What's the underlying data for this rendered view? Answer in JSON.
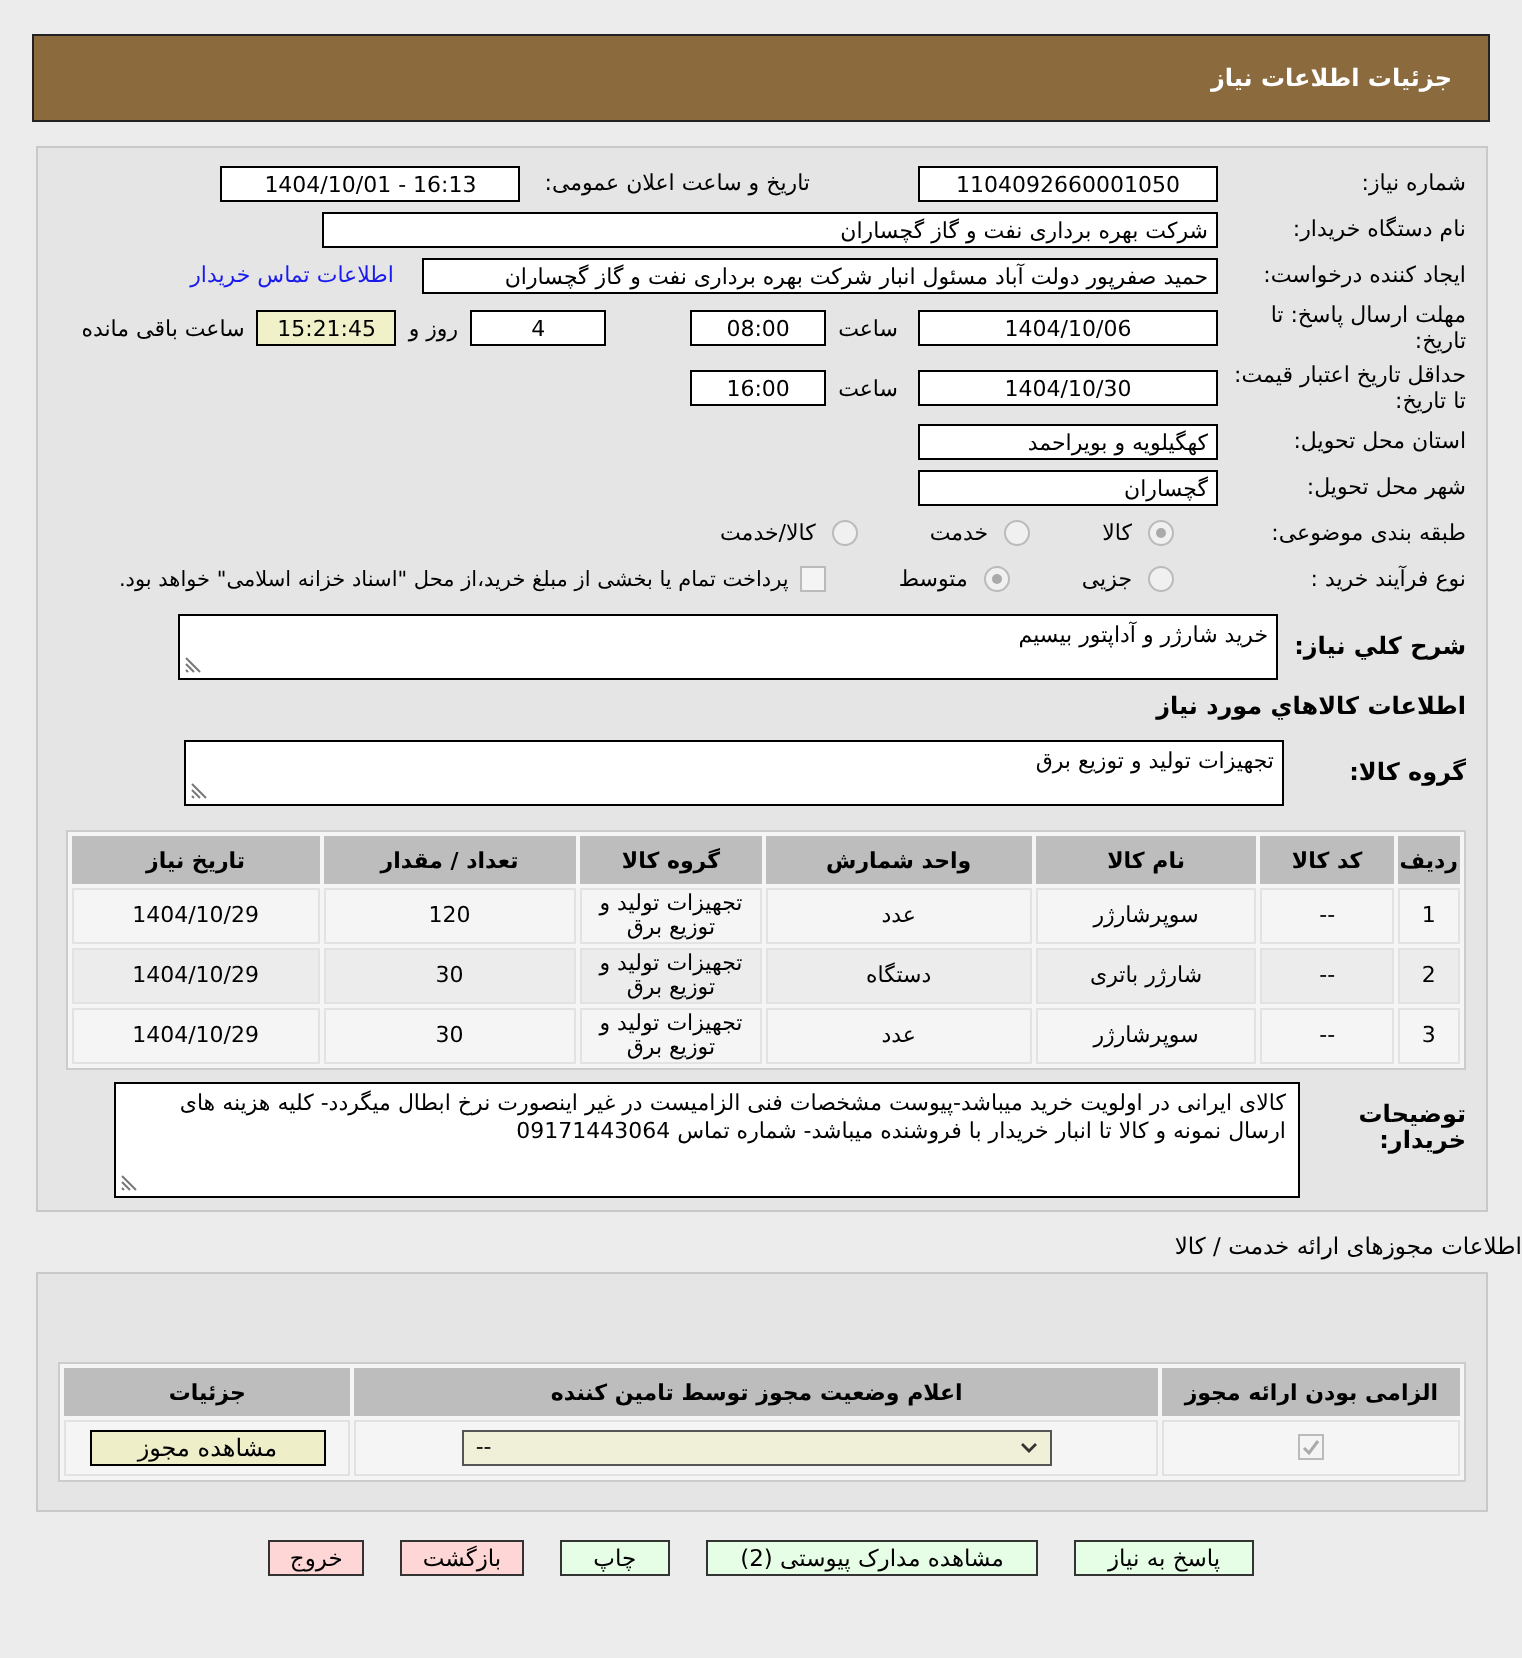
{
  "header": {
    "title": "جزئیات اطلاعات نیاز"
  },
  "need_number": {
    "label": "شماره نیاز:",
    "value": "1104092660001050"
  },
  "announce": {
    "label": "تاریخ و ساعت اعلان عمومی:",
    "value": "1404/10/01 - 16:13"
  },
  "buyer": {
    "label": "نام دستگاه خریدار:",
    "value": "شرکت بهره برداری نفت و گاز گچساران"
  },
  "requester": {
    "label": "ایجاد کننده درخواست:",
    "value": "حمید  صفرپور دولت آباد مسئول انبار شرکت بهره برداری نفت و گاز گچساران",
    "link": "اطلاعات تماس خریدار"
  },
  "deadline": {
    "label": "مهلت ارسال پاسخ: تا تاریخ:",
    "date": "1404/10/06",
    "time_label": "ساعت",
    "time": "08:00",
    "days": "4",
    "days_label": "روز و",
    "remaining": "15:21:45",
    "remaining_label": "ساعت باقی مانده"
  },
  "validity": {
    "label": "حداقل تاریخ اعتبار قیمت: تا تاریخ:",
    "date": "1404/10/30",
    "time_label": "ساعت",
    "time": "16:00"
  },
  "province": {
    "label": "استان محل تحویل:",
    "value": "کهگیلویه و بویراحمد"
  },
  "city": {
    "label": "شهر محل تحویل:",
    "value": "گچساران"
  },
  "category": {
    "label": "طبقه بندی موضوعی:",
    "options": [
      {
        "label": "کالا",
        "selected": true
      },
      {
        "label": "خدمت",
        "selected": false
      },
      {
        "label": "کالا/خدمت",
        "selected": false
      }
    ]
  },
  "process": {
    "label": "نوع فرآیند خرید :",
    "options": [
      {
        "label": "جزیی",
        "selected": false
      },
      {
        "label": "متوسط",
        "selected": true
      }
    ],
    "payment": {
      "label": "پرداخت تمام یا بخشی از مبلغ خرید،از محل \"اسناد خزانه اسلامی\" خواهد بود.",
      "checked": false
    }
  },
  "summary": {
    "label": "شرح كلي نياز:",
    "value": "خرید شارژر و آداپتور بیسیم"
  },
  "goods_heading": "اطلاعات كالاهاي مورد نياز",
  "goods_group": {
    "label": "گروه کالا:",
    "value": "تجهیزات تولید و توزیع برق"
  },
  "goods_table": {
    "columns": [
      "ردیف",
      "کد کالا",
      "نام کالا",
      "واحد شمارش",
      "گروه کالا",
      "تعداد / مقدار",
      "تاریخ نیاز"
    ],
    "rows": [
      [
        "1",
        "--",
        "سوپرشارژر",
        "عدد",
        "تجهیزات تولید و توزیع برق",
        "120",
        "1404/10/29"
      ],
      [
        "2",
        "--",
        "شارژر باتری",
        "دستگاه",
        "تجهیزات تولید و توزیع برق",
        "30",
        "1404/10/29"
      ],
      [
        "3",
        "--",
        "سوپرشارژر",
        "عدد",
        "تجهیزات تولید و توزیع برق",
        "30",
        "1404/10/29"
      ]
    ]
  },
  "buyer_notes": {
    "label": "توضیحات خریدار:",
    "value": "کالای ایرانی در اولویت خرید میباشد-پیوست مشخصات فنی  الزامیست در غیر اینصورت نرخ ابطال میگردد- کلیه هزینه های ارسال نمونه و  کالا  تا انبار خریدار با فروشنده میباشد- شماره تماس 09171443064"
  },
  "permits": {
    "heading": "اطلاعات مجوزهای ارائه خدمت / کالا",
    "columns": [
      "الزامی بودن ارائه مجوز",
      "اعلام وضعیت مجوز توسط تامین کننده",
      "جزئیات"
    ],
    "rows": [
      {
        "required": true,
        "status": "--",
        "button": "مشاهده مجوز"
      }
    ]
  },
  "buttons": [
    {
      "label": "پاسخ به نیاز",
      "kind": "normal"
    },
    {
      "label": "مشاهده مدارک پیوستی (2)",
      "kind": "normal"
    },
    {
      "label": "چاپ",
      "kind": "normal"
    },
    {
      "label": "بازگشت",
      "kind": "danger"
    },
    {
      "label": "خروج",
      "kind": "danger"
    }
  ]
}
